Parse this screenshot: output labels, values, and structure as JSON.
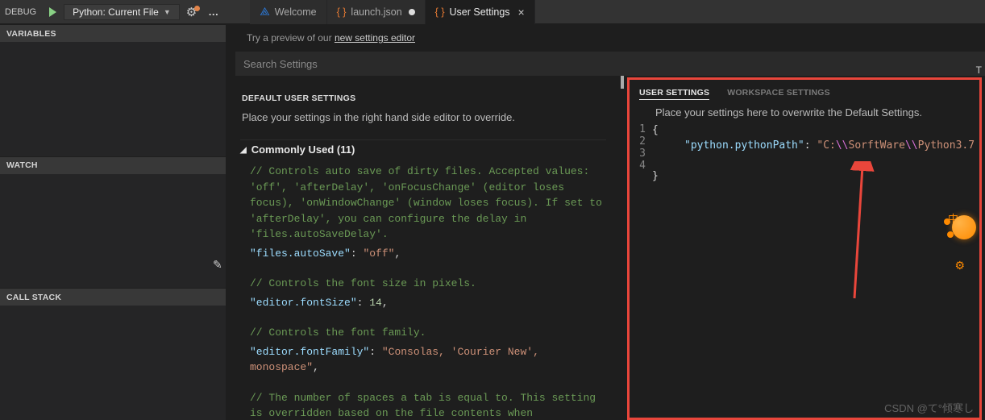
{
  "topbar": {
    "debug_label": "DEBUG",
    "run_config": "Python: Current File",
    "ellipsis": "…"
  },
  "tabs": {
    "welcome": "Welcome",
    "launch": "launch.json",
    "user_settings": "User Settings"
  },
  "sidebar": {
    "variables": "VARIABLES",
    "watch": "WATCH",
    "callstack": "CALL STACK"
  },
  "main": {
    "preview_text": "Try a preview of our ",
    "preview_link": "new settings editor",
    "search_placeholder": "Search Settings",
    "right_t": "T"
  },
  "left": {
    "header": "DEFAULT USER SETTINGS",
    "hint": "Place your settings in the right hand side editor to override.",
    "group": "Commonly Used (11)",
    "block1_comment": "// Controls auto save of dirty files. Accepted values:  'off', 'afterDelay', 'onFocusChange' (editor loses focus), 'onWindowChange' (window loses focus). If set to 'afterDelay', you can configure the delay in 'files.autoSaveDelay'.",
    "block1_key": "\"files.autoSave\"",
    "block1_val": "\"off\"",
    "block2_comment": "// Controls the font size in pixels.",
    "block2_key": "\"editor.fontSize\"",
    "block2_val": "14",
    "block3_comment": "// Controls the font family.",
    "block3_key": "\"editor.fontFamily\"",
    "block3_val": "\"Consolas, 'Courier New', monospace\"",
    "block4_comment": "// The number of spaces a tab is equal to. This setting is overridden based on the file contents when"
  },
  "right": {
    "tab_user": "USER SETTINGS",
    "tab_workspace": "WORKSPACE SETTINGS",
    "hint": "Place your settings here to overwrite the Default Settings.",
    "ln1": "1",
    "ln2": "2",
    "ln3": "3",
    "ln4": "4",
    "brace_open": "{",
    "brace_close": "}",
    "key": "\"python.pythonPath\"",
    "colon": ": ",
    "val_prefix": "\"C:",
    "sep1": "\\\\",
    "seg1": "SorftWare",
    "sep2": "\\\\",
    "seg2": "Python3.7"
  },
  "badge": {
    "zh": "中"
  },
  "watermark": "CSDN @て°倾寒し"
}
